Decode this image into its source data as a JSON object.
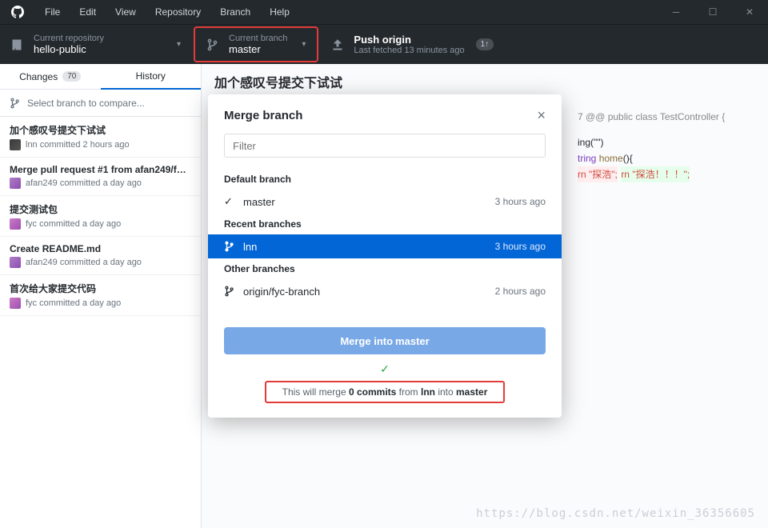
{
  "menubar": [
    "File",
    "Edit",
    "View",
    "Repository",
    "Branch",
    "Help"
  ],
  "toolbar": {
    "repo": {
      "label": "Current repository",
      "value": "hello-public"
    },
    "branch": {
      "label": "Current branch",
      "value": "master"
    },
    "push": {
      "label": "Push origin",
      "value": "Last fetched 13 minutes ago",
      "badge": "1↑"
    }
  },
  "tabs": {
    "changes": "Changes",
    "changes_count": "70",
    "history": "History"
  },
  "compare_placeholder": "Select branch to compare...",
  "commits": [
    {
      "title": "加个感叹号提交下试试",
      "meta": "lnn committed 2 hours ago",
      "av": "av1"
    },
    {
      "title": "Merge pull request #1 from afan249/fyc...",
      "meta": "afan249 committed a day ago",
      "av": "av2"
    },
    {
      "title": "提交测试包",
      "meta": "fyc committed a day ago",
      "av": "av3"
    },
    {
      "title": "Create README.md",
      "meta": "afan249 committed a day ago",
      "av": "av2"
    },
    {
      "title": "首次给大家提交代码",
      "meta": "fyc committed a day ago",
      "av": "av3"
    }
  ],
  "detail_title": "加个感叹号提交下试试",
  "diff": {
    "hunk": "7 @@ public class TestController {",
    "l1a": "ing(\"\")",
    "l2a": "tring ",
    "l2b": "home",
    "l2c": "(){",
    "lm": "rn \"探浩\";",
    "lp": "rn \"探浩！！！\";"
  },
  "modal": {
    "title": "Merge branch",
    "filter_placeholder": "Filter",
    "sections": {
      "default": "Default branch",
      "recent": "Recent branches",
      "other": "Other branches"
    },
    "branches": {
      "default": {
        "name": "master",
        "time": "3 hours ago"
      },
      "recent": {
        "name": "lnn",
        "time": "3 hours ago"
      },
      "other": {
        "name": "origin/fyc-branch",
        "time": "2 hours ago"
      }
    },
    "merge_btn_pre": "Merge into ",
    "merge_btn_target": "master",
    "msg": {
      "a": "This will merge ",
      "b": "0 commits",
      "c": " from ",
      "d": "lnn",
      "e": " into ",
      "f": "master"
    }
  },
  "watermark": "https://blog.csdn.net/weixin_36356605"
}
